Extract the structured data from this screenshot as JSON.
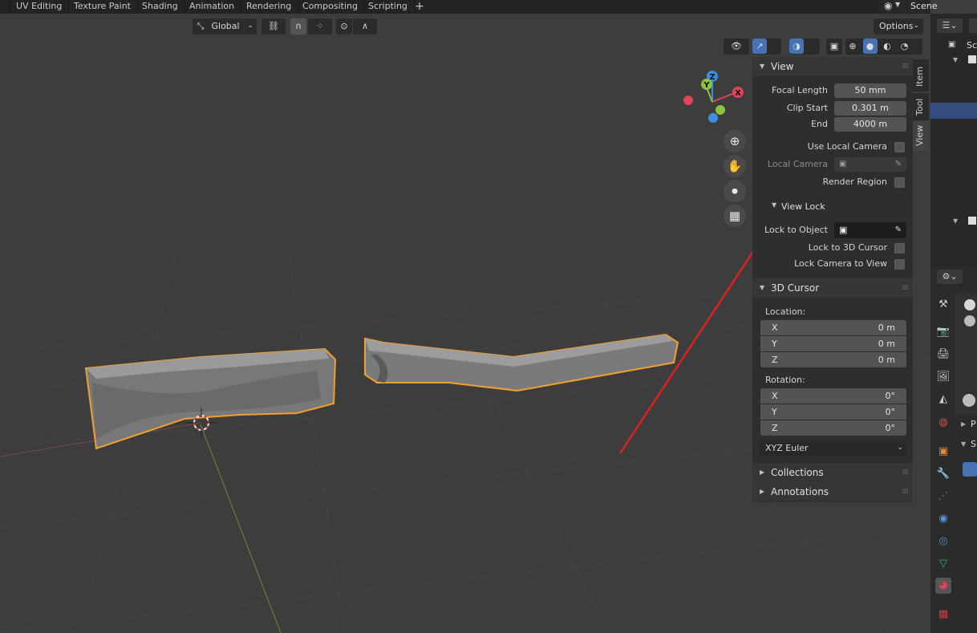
{
  "workspace_tabs": [
    "UV Editing",
    "Texture Paint",
    "Shading",
    "Animation",
    "Rendering",
    "Compositing",
    "Scripting"
  ],
  "add_tab": "+",
  "scene_name": "Scene",
  "header": {
    "transform_orientation": "Global",
    "options_label": "Options"
  },
  "npanel": {
    "tabs": [
      "Item",
      "Tool",
      "View"
    ],
    "view_section": {
      "title": "View",
      "focal_length": {
        "label": "Focal Length",
        "value": "50 mm"
      },
      "clip_start": {
        "label": "Clip Start",
        "value": "0.301 m"
      },
      "clip_end": {
        "label": "End",
        "value": "4000 m"
      },
      "use_local_camera": {
        "label": "Use Local Camera",
        "checked": false
      },
      "local_camera_label": "Local Camera",
      "render_region": {
        "label": "Render Region",
        "checked": false
      }
    },
    "view_lock": {
      "title": "View Lock",
      "lock_to_object": "Lock to Object",
      "lock_to_3d_cursor": {
        "label": "Lock to 3D Cursor",
        "checked": false
      },
      "lock_camera_to_view": {
        "label": "Lock Camera to View",
        "checked": false
      }
    },
    "cursor_section": {
      "title": "3D Cursor",
      "location_label": "Location:",
      "location": [
        {
          "axis": "X",
          "value": "0 m"
        },
        {
          "axis": "Y",
          "value": "0 m"
        },
        {
          "axis": "Z",
          "value": "0 m"
        }
      ],
      "rotation_label": "Rotation:",
      "rotation": [
        {
          "axis": "X",
          "value": "0°"
        },
        {
          "axis": "Y",
          "value": "0°"
        },
        {
          "axis": "Z",
          "value": "0°"
        }
      ],
      "rotation_mode": "XYZ Euler"
    },
    "collections_title": "Collections",
    "annotations_title": "Annotations"
  },
  "gizmo": {
    "x_label": "X",
    "y_label": "Y",
    "z_label": "Z"
  },
  "outliner_label": "Sc",
  "props_labels": [
    "P",
    "S"
  ],
  "colors": {
    "selection_outline": "#f0a030",
    "annotation_arrow": "#e02020",
    "axis_x": "#e0435a",
    "axis_y": "#8bc33c",
    "axis_z": "#3b8fe0",
    "active_highlight": "#4772b3"
  }
}
